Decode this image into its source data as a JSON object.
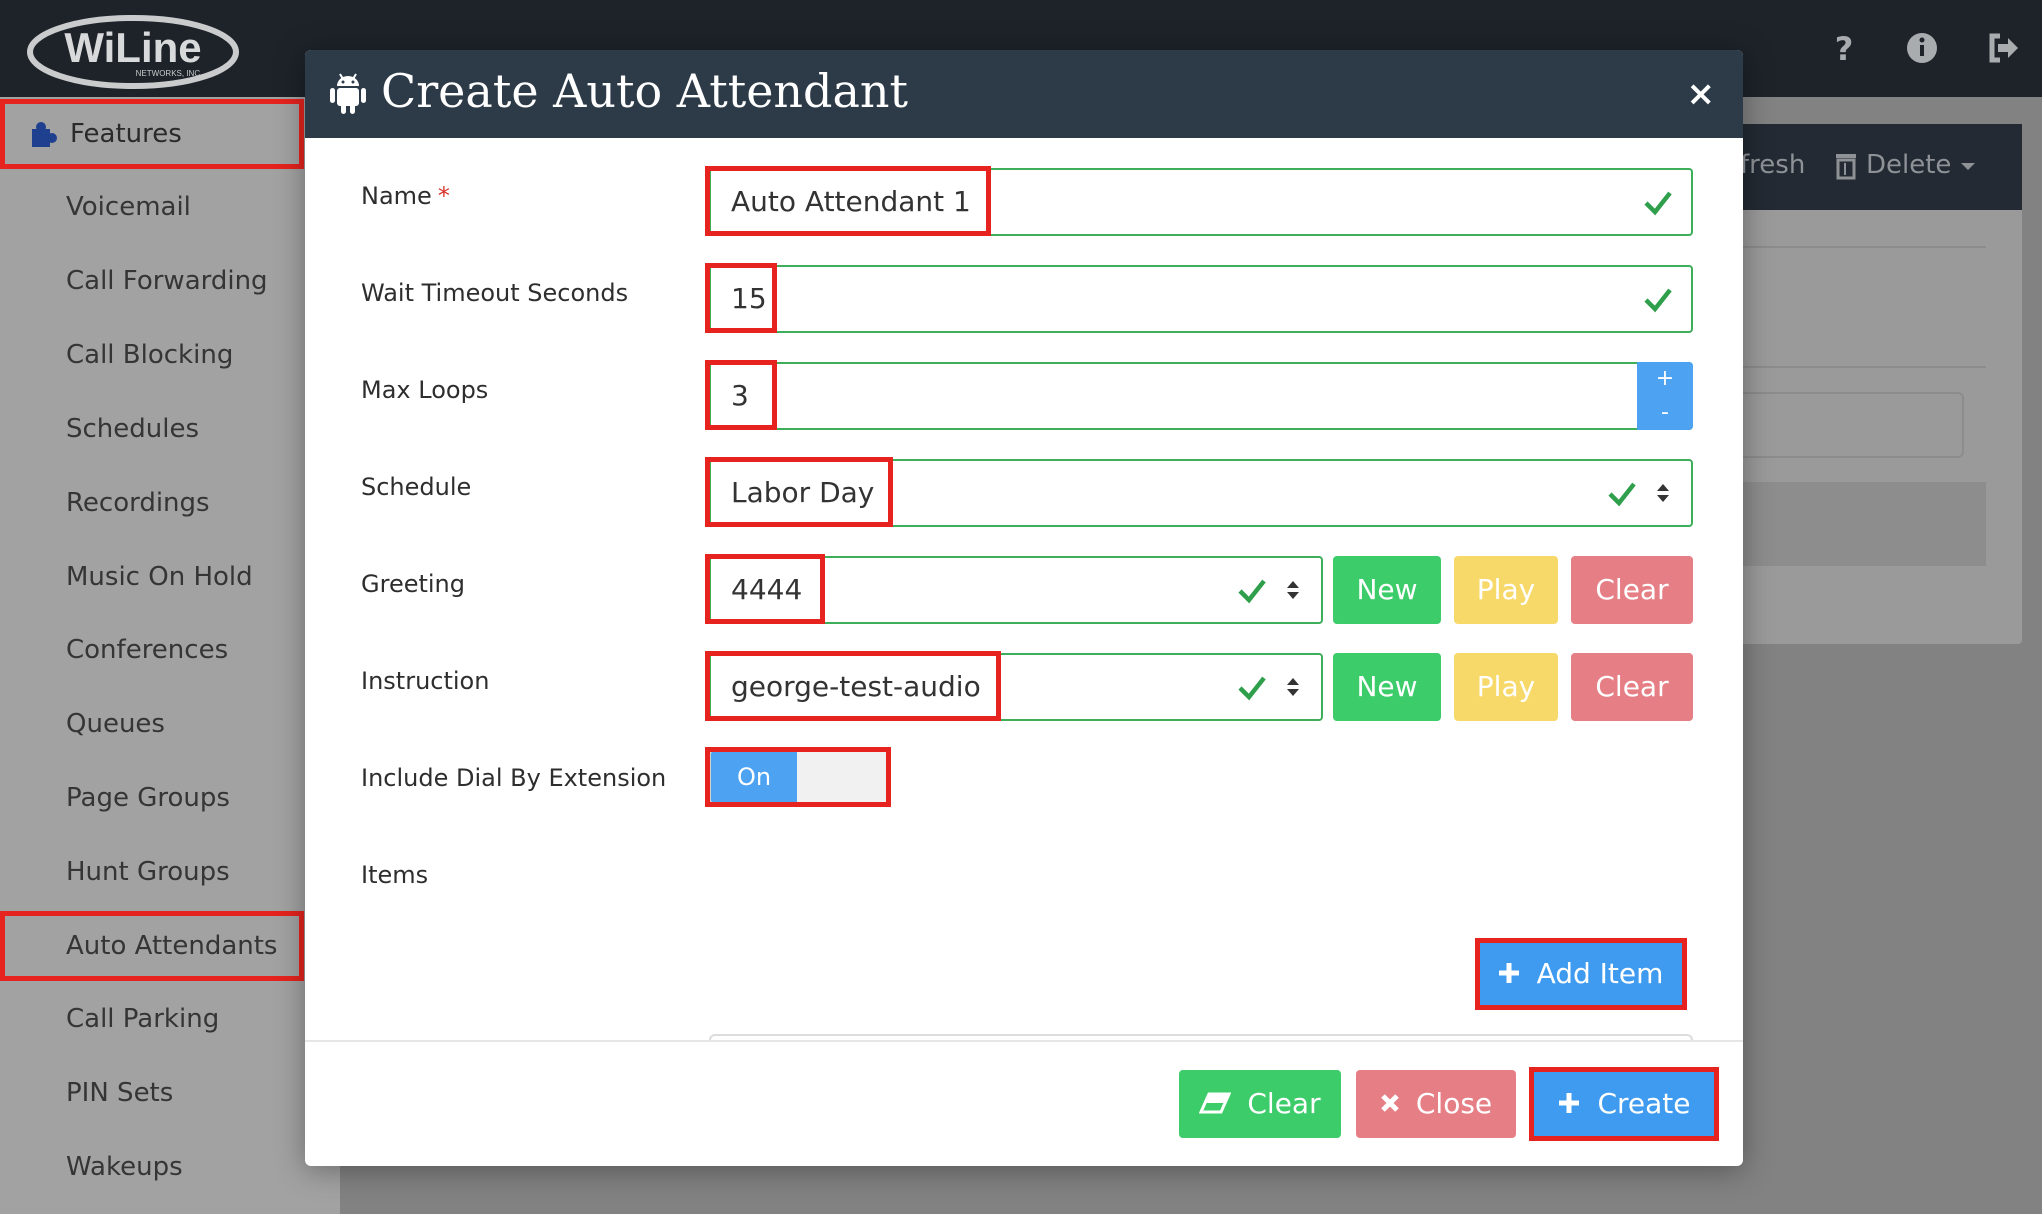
{
  "brand": {
    "name": "WiLine",
    "subtitle": "NETWORKS, INC."
  },
  "topbar": {
    "icons": [
      "question-icon",
      "info-icon",
      "logout-icon"
    ]
  },
  "sidebar": {
    "header": "Features",
    "items": [
      {
        "label": "Voicemail"
      },
      {
        "label": "Call Forwarding"
      },
      {
        "label": "Call Blocking"
      },
      {
        "label": "Schedules"
      },
      {
        "label": "Recordings"
      },
      {
        "label": "Music On Hold"
      },
      {
        "label": "Conferences"
      },
      {
        "label": "Queues"
      },
      {
        "label": "Page Groups"
      },
      {
        "label": "Hunt Groups"
      },
      {
        "label": "Auto Attendants"
      },
      {
        "label": "Call Parking"
      },
      {
        "label": "PIN Sets"
      },
      {
        "label": "Wakeups"
      }
    ],
    "active": "Auto Attendants"
  },
  "background_toolbar": {
    "refresh_label": "fresh",
    "delete_label": "Delete"
  },
  "modal": {
    "title": "Create Auto Attendant",
    "close_symbol": "×",
    "fields": {
      "name": {
        "label": "Name",
        "required_mark": "*",
        "value": "Auto Attendant 1"
      },
      "wait_timeout": {
        "label": "Wait Timeout Seconds",
        "value": "15"
      },
      "max_loops": {
        "label": "Max Loops",
        "value": "3",
        "inc": "+",
        "dec": "-"
      },
      "schedule": {
        "label": "Schedule",
        "value": "Labor Day"
      },
      "greeting": {
        "label": "Greeting",
        "value": "4444"
      },
      "instruction": {
        "label": "Instruction",
        "value": "george-test-audio"
      },
      "dial_by_extension": {
        "label": "Include Dial By Extension",
        "toggle_label": "On"
      },
      "items": {
        "label": "Items"
      }
    },
    "row_buttons": {
      "new": "New",
      "play": "Play",
      "clear": "Clear"
    },
    "add_item_label": "Add Item",
    "footer": {
      "clear": "Clear",
      "close": "Close",
      "create": "Create"
    }
  },
  "colors": {
    "highlight": "#e6231e",
    "valid_green": "#3fae5b",
    "btn_green": "#3dcc6a",
    "btn_yellow": "#f7d96a",
    "btn_red": "#e67f85",
    "btn_blue": "#3e9bf0",
    "modal_header": "#2d3a48"
  }
}
